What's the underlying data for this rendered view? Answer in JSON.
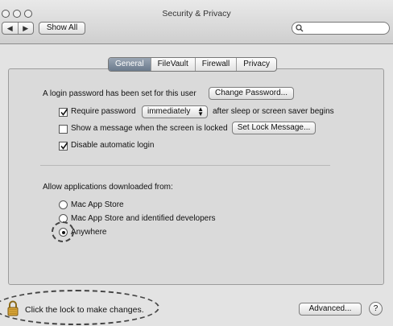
{
  "window": {
    "title": "Security & Privacy"
  },
  "toolbar": {
    "back_icon": "◀",
    "forward_icon": "▶",
    "show_all": "Show All",
    "search_placeholder": ""
  },
  "tabs": [
    {
      "label": "General",
      "active": true
    },
    {
      "label": "FileVault",
      "active": false
    },
    {
      "label": "Firewall",
      "active": false
    },
    {
      "label": "Privacy",
      "active": false
    }
  ],
  "general": {
    "login_password_text": "A login password has been set for this user",
    "change_password_button": "Change Password...",
    "require_password": {
      "label": "Require password",
      "checked": true
    },
    "require_password_select": "immediately",
    "require_password_suffix": "after sleep or screen saver begins",
    "show_message": {
      "label": "Show a message when the screen is locked",
      "checked": false
    },
    "set_lock_message_button": "Set Lock Message...",
    "disable_auto_login": {
      "label": "Disable automatic login",
      "checked": true
    }
  },
  "downloads": {
    "heading": "Allow applications downloaded from:",
    "options": [
      {
        "label": "Mac App Store",
        "selected": false
      },
      {
        "label": "Mac App Store and identified developers",
        "selected": false
      },
      {
        "label": "Anywhere",
        "selected": true
      }
    ]
  },
  "footer": {
    "lock_text": "Click the lock to make changes.",
    "advanced_button": "Advanced...",
    "help_label": "?"
  }
}
